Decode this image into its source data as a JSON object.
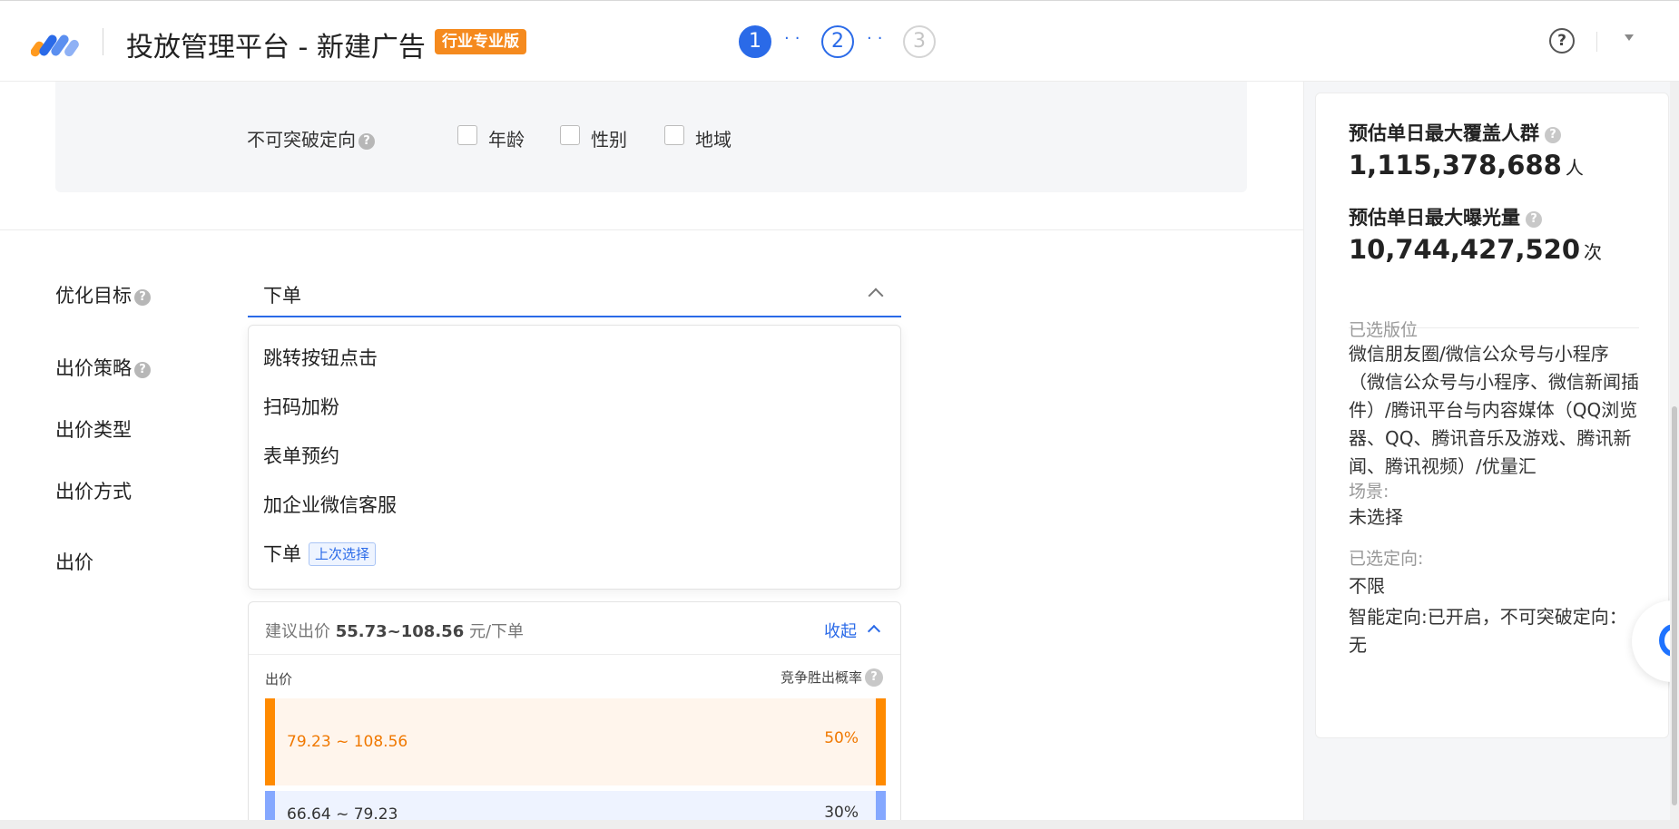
{
  "header": {
    "app_title": "投放管理平台 - 新建广告",
    "edition_badge": "行业专业版",
    "steps": [
      "1",
      "2",
      "3"
    ],
    "help": "?"
  },
  "targeting": {
    "no_break_label": "不可突破定向",
    "options": [
      "年龄",
      "性别",
      "地域"
    ]
  },
  "form": {
    "optimize_label": "优化目标",
    "bid_strategy_label": "出价策略",
    "bid_type_label": "出价类型",
    "bid_method_label": "出价方式",
    "bid_label": "出价",
    "selected_goal": "下单"
  },
  "dropdown": {
    "items": [
      "跳转按钮点击",
      "扫码加粉",
      "表单预约",
      "加企业微信客服",
      "下单"
    ],
    "last_choice_badge": "上次选择"
  },
  "suggest": {
    "label": "建议出价",
    "range": "55.73~108.56",
    "unit": "元/下单",
    "collapse": "收起",
    "col_price": "出价",
    "col_prob": "竞争胜出概率",
    "bands": [
      {
        "range": "79.23 ~ 108.56",
        "pct": "50%"
      },
      {
        "range": "66.64 ~ 79.23",
        "pct": "30%"
      }
    ]
  },
  "sidebar": {
    "coverage_title": "预估单日最大覆盖人群",
    "coverage_value": "1,115,378,688",
    "coverage_unit": "人",
    "exposure_title": "预估单日最大曝光量",
    "exposure_value": "10,744,427,520",
    "exposure_unit": "次",
    "placement_key": "已选版位",
    "placement_value": "微信朋友圈/微信公众号与小程序（微信公众号与小程序、微信新闻插件）/腾讯平台与内容媒体（QQ浏览器、QQ、腾讯音乐及游戏、腾讯新闻、腾讯视频）/优量汇",
    "scene_key": "场景:",
    "scene_value": "未选择",
    "targeting_key": "已选定向:",
    "targeting_value": "不限",
    "smart_targeting": "智能定向:已开启，不可突破定向：无"
  },
  "colors": {
    "primary": "#2a6ae8",
    "badge_orange": "#f58a1e",
    "band_orange": "#ff8a00",
    "band_blue": "#85a8ff"
  }
}
